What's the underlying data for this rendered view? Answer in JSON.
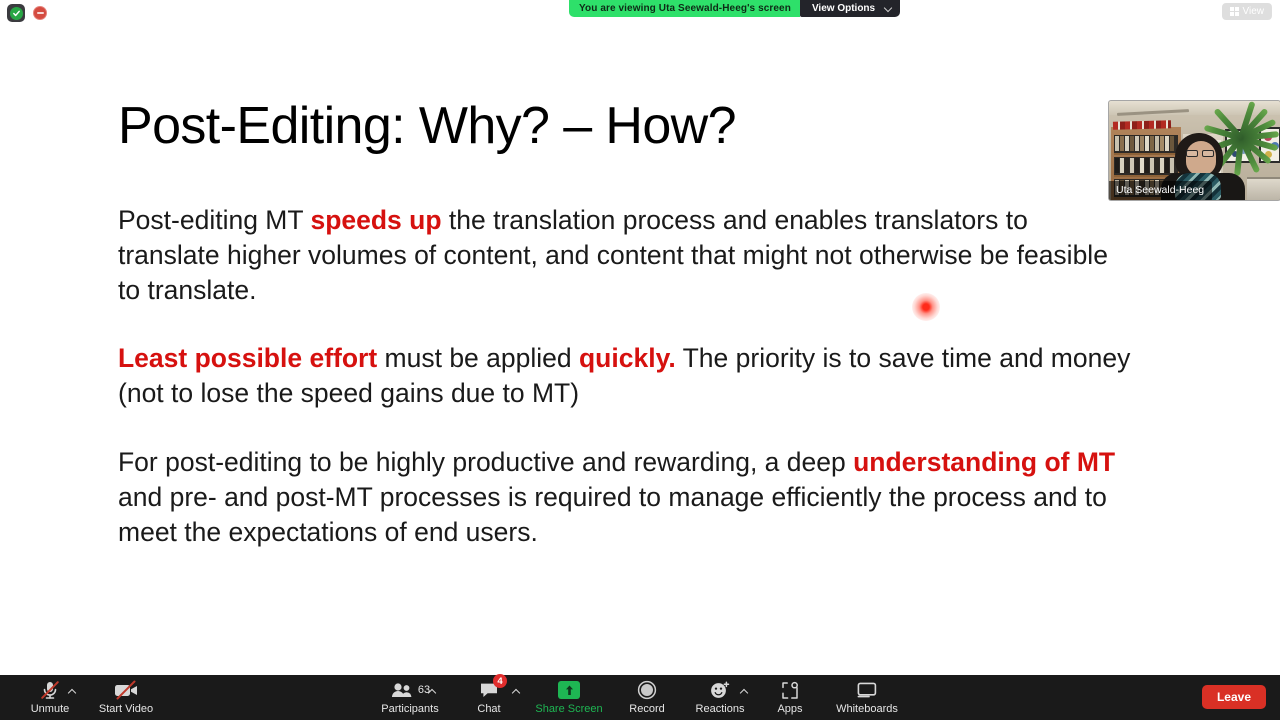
{
  "top_bar": {
    "shield_icon": "security-shield-icon",
    "record_indicator_icon": "recording-indicator-icon",
    "viewing_banner": "You are viewing Uta Seewald-Heeg's screen",
    "view_options_label": "View Options",
    "view_options_chevron": "chevron-down-icon",
    "view_pill_label": "View",
    "view_pill_icon": "grid-layout-icon"
  },
  "slide": {
    "title": "Post-Editing: Why? – How?",
    "paragraph1": {
      "before": "Post-editing MT ",
      "highlight": "speeds up",
      "after": " the translation process and enables translators to translate higher volumes of content, and content that might not otherwise be feasible to translate."
    },
    "paragraph2": {
      "highlight1": "Least possible effort",
      "middle": " must be applied ",
      "highlight2": "quickly.",
      "after": " The priority is to save time and money (not to lose the speed gains due to MT)"
    },
    "paragraph3": {
      "before": "For post-editing to be highly productive and rewarding, a deep ",
      "highlight": "understanding of MT",
      "after": " and pre- and post-MT processes is required to manage efficiently the process and to meet the expectations of end users."
    },
    "highlight_color": "#d6110f",
    "annotation_dot": "laser-pointer-dot"
  },
  "video_thumbnail": {
    "participant_name": "Uta Seewald-Heeg"
  },
  "toolbar": {
    "mic": {
      "label": "Unmute",
      "icon": "microphone-muted-icon",
      "caret": "chevron-up-icon"
    },
    "video": {
      "label": "Start Video",
      "icon": "video-camera-off-icon"
    },
    "participants": {
      "label": "Participants",
      "icon": "participants-icon",
      "count": "63",
      "caret": "chevron-up-icon"
    },
    "chat": {
      "label": "Chat",
      "icon": "chat-bubble-icon",
      "badge": "4",
      "caret": "chevron-up-icon"
    },
    "share_screen": {
      "label": "Share Screen",
      "icon": "share-screen-up-arrow-icon"
    },
    "record": {
      "label": "Record",
      "icon": "record-circle-icon"
    },
    "reactions": {
      "label": "Reactions",
      "icon": "smiley-reaction-icon",
      "caret": "chevron-up-icon"
    },
    "apps": {
      "label": "Apps",
      "icon": "apps-icon"
    },
    "whiteboards": {
      "label": "Whiteboards",
      "icon": "whiteboard-icon"
    },
    "leave": {
      "label": "Leave",
      "color": "#d93025"
    }
  }
}
